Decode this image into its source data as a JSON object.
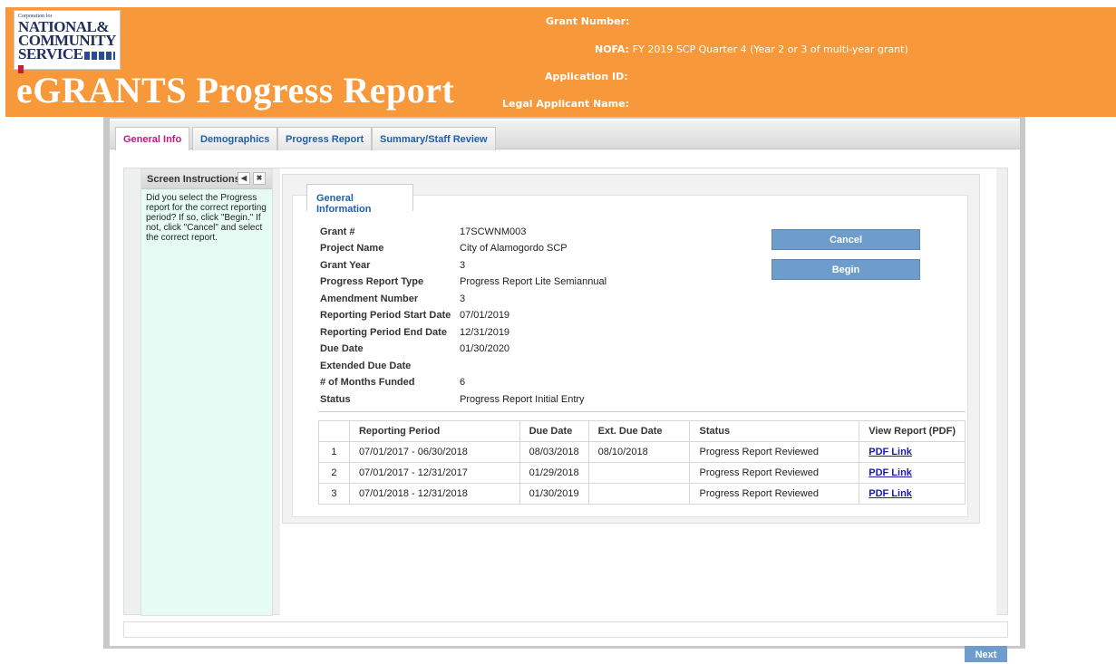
{
  "header": {
    "logo_small": "Corporation for",
    "logo_line1": "NATIONAL&",
    "logo_line2": "COMMUNITY",
    "logo_line3": "SERVICE",
    "title": "eGRANTS Progress Report",
    "grant_number_label": "Grant Number:",
    "nofa_label": "NOFA:",
    "nofa_value": "FY 2019 SCP Quarter 4 (Year 2 or 3 of multi-year grant)",
    "application_id_label": "Application ID:",
    "legal_applicant_label": "Legal Applicant Name:"
  },
  "tabs": [
    {
      "label": "General Info",
      "active": true
    },
    {
      "label": "Demographics",
      "active": false
    },
    {
      "label": "Progress Report",
      "active": false
    },
    {
      "label": "Summary/Staff Review",
      "active": false
    }
  ],
  "sidebar": {
    "title": "Screen Instructions",
    "collapse_icon": "caret-left-icon",
    "close_icon": "close-icon",
    "text": "Did you select the Progress report for the correct reporting period? If so, click \"Begin.\"  If not, click \"Cancel\" and select the correct report."
  },
  "general_info": {
    "tab_label": "General Information",
    "fields": [
      {
        "label": "Grant #",
        "value": "17SCWNM003"
      },
      {
        "label": "Project Name",
        "value": "City of Alamogordo SCP"
      },
      {
        "label": "Grant Year",
        "value": "3"
      },
      {
        "label": "Progress Report Type",
        "value": "Progress Report Lite Semiannual"
      },
      {
        "label": "Amendment Number",
        "value": "3"
      },
      {
        "label": "Reporting Period Start Date",
        "value": "07/01/2019"
      },
      {
        "label": "Reporting Period End Date",
        "value": "12/31/2019"
      },
      {
        "label": "Due Date",
        "value": "01/30/2020"
      },
      {
        "label": "Extended Due Date",
        "value": ""
      },
      {
        "label": "# of Months Funded",
        "value": "6"
      },
      {
        "label": "Status",
        "value": "Progress Report Initial Entry"
      }
    ],
    "cancel_label": "Cancel",
    "begin_label": "Begin"
  },
  "report_table": {
    "headers": [
      "",
      "Reporting Period",
      "Due Date",
      "Ext. Due Date",
      "Status",
      "View Report (PDF)"
    ],
    "rows": [
      {
        "num": "1",
        "period": "07/01/2017 - 06/30/2018",
        "due": "08/03/2018",
        "ext": "08/10/2018",
        "status": "Progress Report Reviewed",
        "link": "PDF Link"
      },
      {
        "num": "2",
        "period": "07/01/2017 - 12/31/2017",
        "due": "01/29/2018",
        "ext": "",
        "status": "Progress Report Reviewed",
        "link": "PDF Link"
      },
      {
        "num": "3",
        "period": "07/01/2018 - 12/31/2018",
        "due": "01/30/2019",
        "ext": "",
        "status": "Progress Report Reviewed",
        "link": "PDF Link"
      }
    ]
  },
  "footer": {
    "next_label": "Next"
  }
}
